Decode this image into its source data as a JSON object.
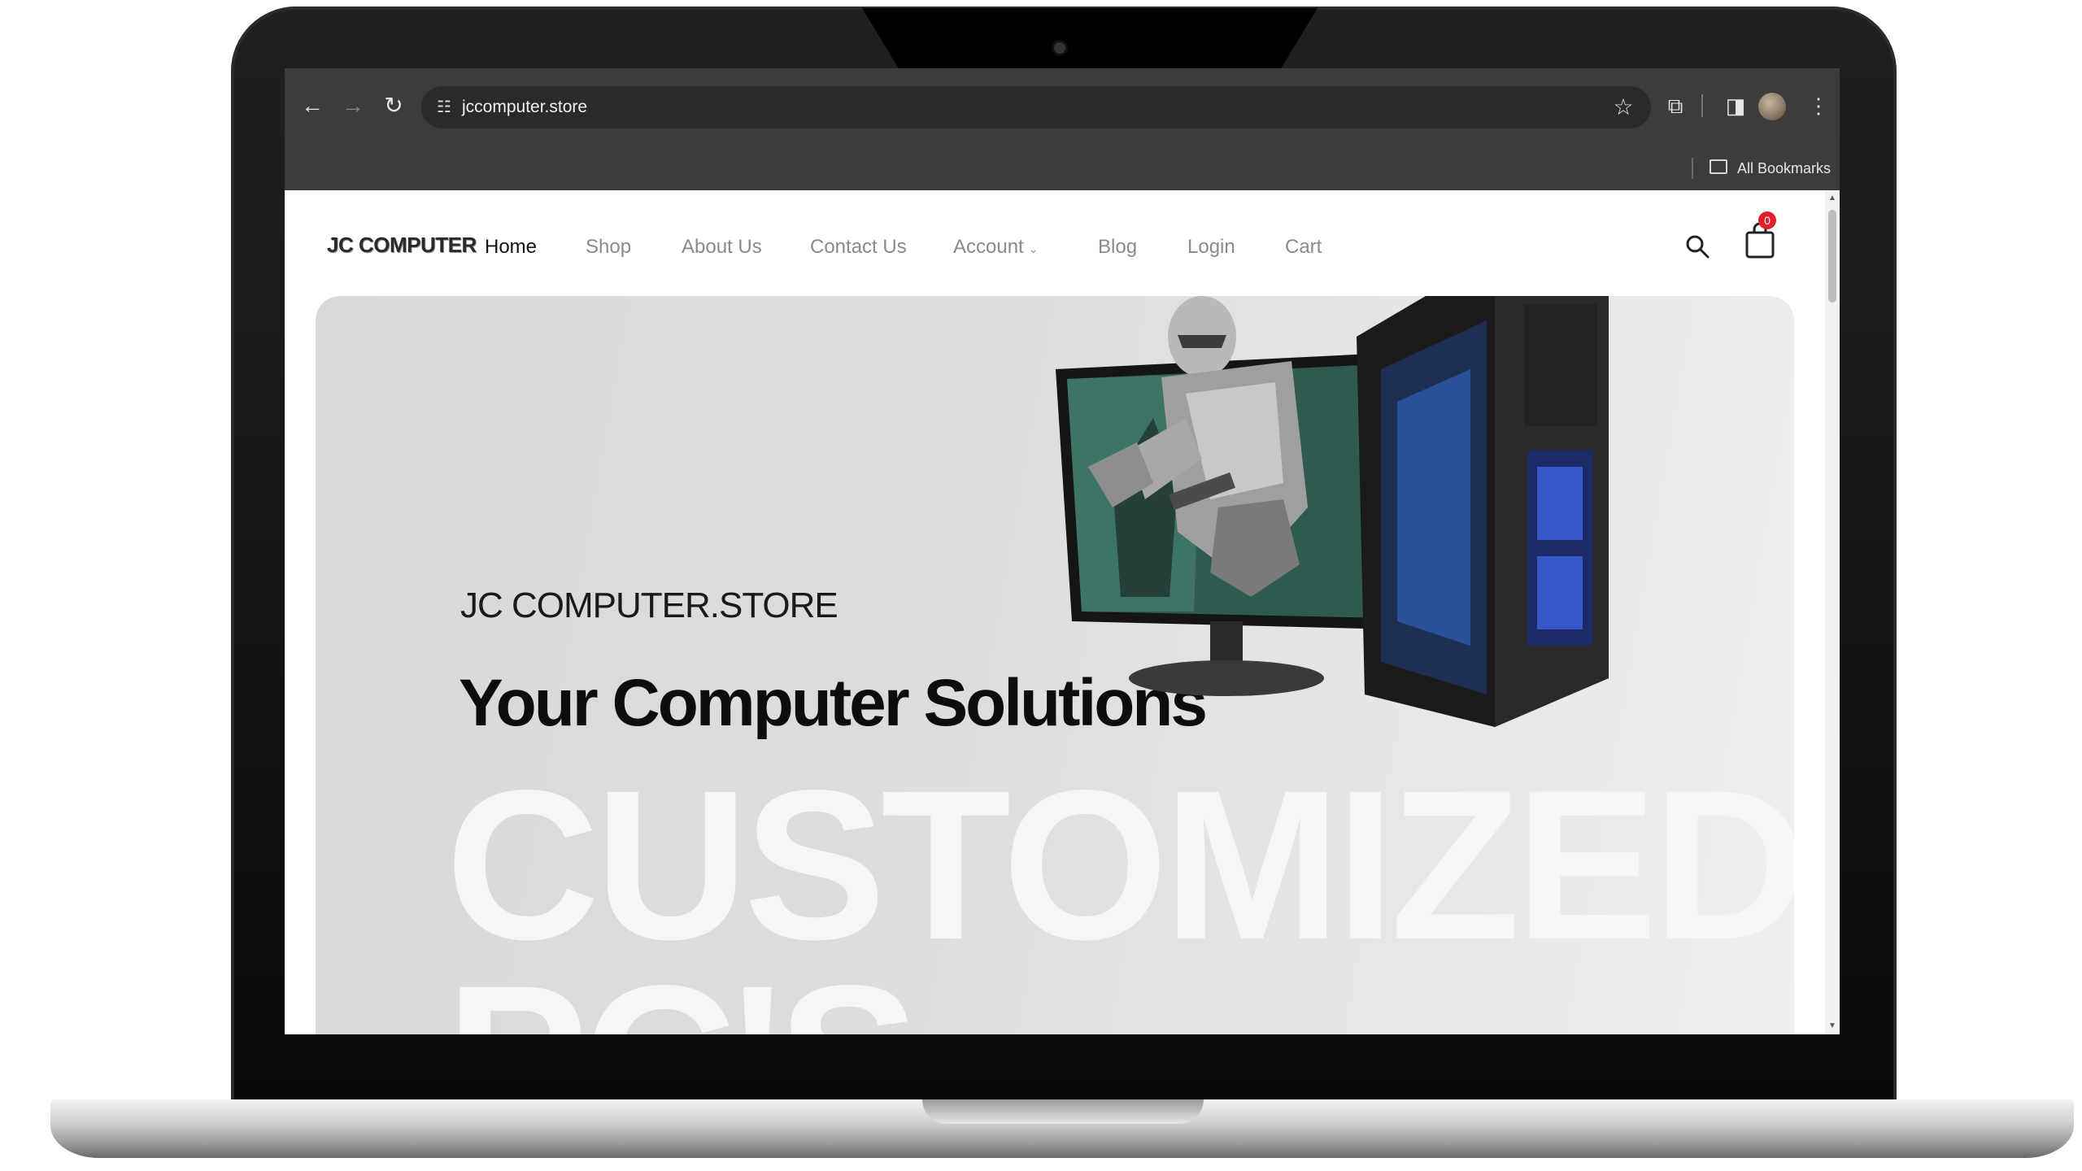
{
  "browser": {
    "url": "jccomputer.store",
    "bookmarks_label": "All Bookmarks"
  },
  "site": {
    "logo": "JC COMPUTER",
    "menu": [
      {
        "label": "Home",
        "active": true
      },
      {
        "label": "Shop"
      },
      {
        "label": "About Us"
      },
      {
        "label": "Contact Us"
      },
      {
        "label": "Account"
      },
      {
        "label": "Blog"
      },
      {
        "label": "Login"
      },
      {
        "label": "Cart"
      }
    ],
    "cart_count": "0"
  },
  "hero": {
    "kicker": "JC COMPUTER.STORE",
    "title": "Your Computer Solutions",
    "bg_word_1": "CUSTOMIZED",
    "bg_word_2": "PC'S"
  },
  "colors": {
    "badge": "#e2202b",
    "chrome": "#3c3c3c"
  }
}
